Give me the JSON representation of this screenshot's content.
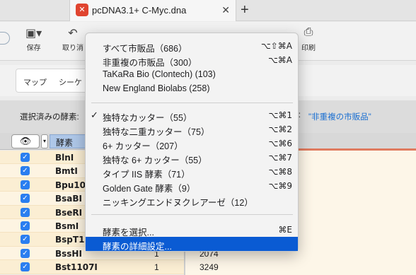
{
  "tab": {
    "title": "pcDNA3.1+ C-Myc.dna",
    "icon": "snapgene-icon",
    "close": "✕",
    "add": "+"
  },
  "toolbar": {
    "items": [
      {
        "label": "保存",
        "icon": "save-icon"
      },
      {
        "label": "取り消",
        "icon": "undo-icon"
      },
      {
        "label": "印刷",
        "icon": "print-icon"
      }
    ]
  },
  "viewbar": {
    "tabs": [
      "マップ",
      "シーケ"
    ]
  },
  "selection": {
    "label": "選択済みの酵素:",
    "right_label": "k:",
    "right_value": "\"非重複の市販品\""
  },
  "table": {
    "header": {
      "eye": "👁",
      "enzyme_col": "酵素"
    },
    "rows": [
      {
        "name": "BlnI",
        "count": "",
        "value": ""
      },
      {
        "name": "BmtI",
        "count": "",
        "value": ""
      },
      {
        "name": "Bpu10",
        "count": "",
        "value": ""
      },
      {
        "name": "BsaBI",
        "count": "",
        "value": ""
      },
      {
        "name": "BseRI",
        "count": "",
        "value": ""
      },
      {
        "name": "BsmI",
        "count": "",
        "value": ""
      },
      {
        "name": "BspT1",
        "count": "",
        "value": ""
      },
      {
        "name": "BssHI",
        "count": "1",
        "value": "2074"
      },
      {
        "name": "Bst1107I",
        "count": "1",
        "value": "3249"
      }
    ]
  },
  "menu": {
    "group1": [
      {
        "label": "すべて市販品（686）",
        "shortcut": "⌥⇧⌘A"
      },
      {
        "label": "非重複の市販品（300）",
        "shortcut": "⌥⌘A"
      },
      {
        "label": "TaKaRa Bio (Clontech) (103)",
        "shortcut": ""
      },
      {
        "label": "New England Biolabs (258)",
        "shortcut": ""
      }
    ],
    "group2": [
      {
        "label": "独特なカッター（55）",
        "shortcut": "⌥⌘1",
        "checked": true
      },
      {
        "label": "独特な二重カッター（75）",
        "shortcut": "⌥⌘2",
        "checked": false
      },
      {
        "label": "6+ カッター（207）",
        "shortcut": "⌥⌘6",
        "checked": false
      },
      {
        "label": "独特な 6+ カッター（55）",
        "shortcut": "⌥⌘7",
        "checked": false
      },
      {
        "label": "タイプ IIS 酵素（71）",
        "shortcut": "⌥⌘8",
        "checked": false
      },
      {
        "label": "Golden Gate 酵素（9）",
        "shortcut": "⌥⌘9",
        "checked": false
      },
      {
        "label": "ニッキングエンドヌクレアーゼ（12）",
        "shortcut": "",
        "checked": false
      }
    ],
    "group3": [
      {
        "label": "酵素を選択...",
        "shortcut": "⌘E",
        "highlighted": false
      },
      {
        "label": "酵素の詳細設定...",
        "shortcut": "",
        "highlighted": true
      }
    ],
    "check_glyph": "✓"
  },
  "colors": {
    "highlight": "#0a5bd3",
    "link": "#1b6fd1",
    "row": "#fbeed3"
  }
}
